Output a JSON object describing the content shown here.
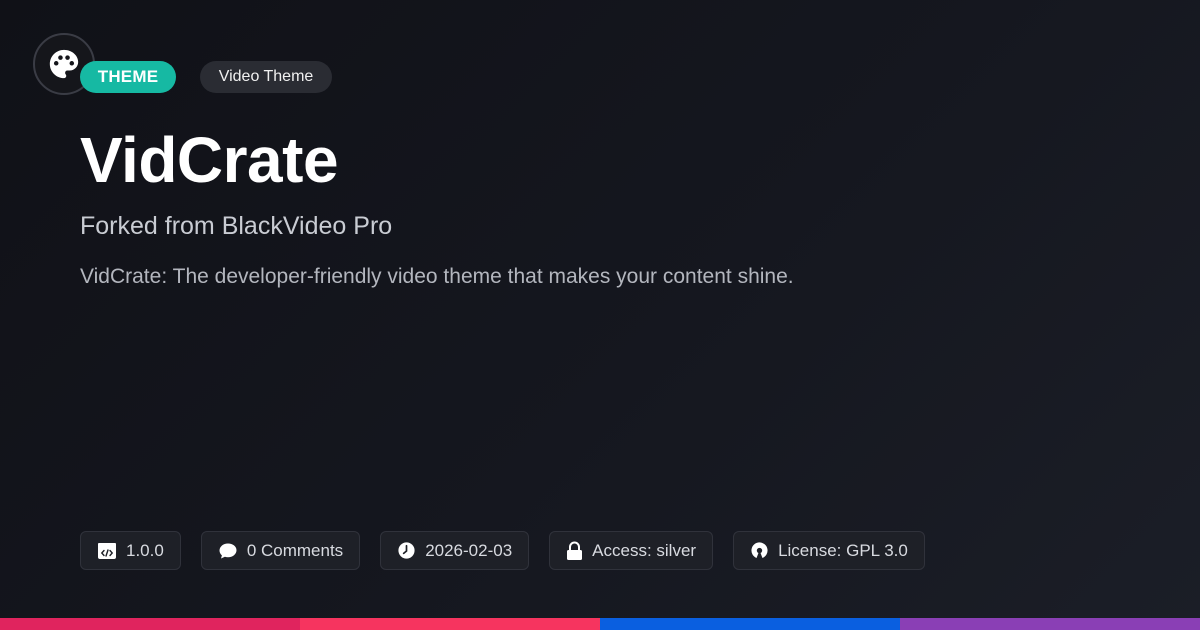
{
  "header": {
    "type_badge": "THEME",
    "category_badge": "Video Theme",
    "logo_icon": "palette-icon"
  },
  "main": {
    "title": "VidCrate",
    "subtitle": "Forked from BlackVideo Pro",
    "description": "VidCrate: The developer-friendly video theme that makes your content shine."
  },
  "meta": {
    "version": "1.0.0",
    "comments": "0 Comments",
    "date": "2026-02-03",
    "access": "Access: silver",
    "license": "License: GPL 3.0"
  },
  "colors": {
    "accent": "#16b9a3",
    "bar": [
      "#e0245e",
      "#f6345f",
      "#0a5fe0",
      "#8a3fb5"
    ]
  }
}
